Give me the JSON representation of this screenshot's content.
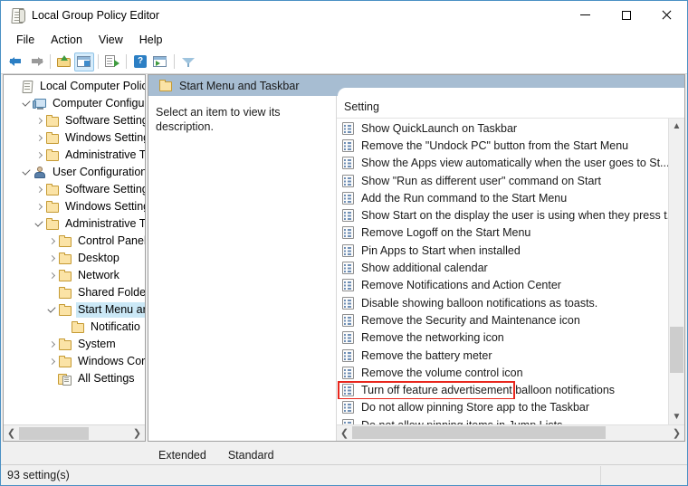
{
  "window": {
    "title": "Local Group Policy Editor",
    "icon": "policy-document-icon",
    "controls": {
      "minimize": "Minimize",
      "maximize": "Maximize",
      "close": "Close"
    }
  },
  "menubar": {
    "items": [
      {
        "label": "File"
      },
      {
        "label": "Action"
      },
      {
        "label": "View"
      },
      {
        "label": "Help"
      }
    ]
  },
  "toolbar": {
    "buttons": [
      {
        "name": "back-arrow-icon",
        "enabled": true
      },
      {
        "name": "forward-arrow-icon",
        "enabled": false
      },
      {
        "name": "up-one-level-icon",
        "enabled": true
      },
      {
        "name": "show-hide-console-tree-icon",
        "selected": true
      },
      {
        "name": "properties-icon",
        "enabled": true
      },
      {
        "name": "help-icon",
        "label": "?"
      },
      {
        "name": "show-action-pane-icon",
        "enabled": true
      },
      {
        "name": "filter-icon",
        "enabled": true
      }
    ]
  },
  "tree": {
    "items": [
      {
        "label": "Local Computer Policy",
        "indent": 0,
        "twisty": "none",
        "icon": "policy-document-icon",
        "selected": false
      },
      {
        "label": "Computer Configura",
        "indent": 1,
        "twisty": "open",
        "icon": "computer-icon",
        "selected": false
      },
      {
        "label": "Software Settings",
        "indent": 2,
        "twisty": "closed",
        "icon": "folder-icon",
        "selected": false
      },
      {
        "label": "Windows Setting",
        "indent": 2,
        "twisty": "closed",
        "icon": "folder-icon",
        "selected": false
      },
      {
        "label": "Administrative Te",
        "indent": 2,
        "twisty": "closed",
        "icon": "folder-icon",
        "selected": false
      },
      {
        "label": "User Configuration",
        "indent": 1,
        "twisty": "open",
        "icon": "user-icon",
        "selected": false
      },
      {
        "label": "Software Settings",
        "indent": 2,
        "twisty": "closed",
        "icon": "folder-icon",
        "selected": false
      },
      {
        "label": "Windows Setting",
        "indent": 2,
        "twisty": "closed",
        "icon": "folder-icon",
        "selected": false
      },
      {
        "label": "Administrative Te",
        "indent": 2,
        "twisty": "open",
        "icon": "folder-icon",
        "selected": false
      },
      {
        "label": "Control Panel",
        "indent": 3,
        "twisty": "closed",
        "icon": "folder-icon",
        "selected": false
      },
      {
        "label": "Desktop",
        "indent": 3,
        "twisty": "closed",
        "icon": "folder-icon",
        "selected": false
      },
      {
        "label": "Network",
        "indent": 3,
        "twisty": "closed",
        "icon": "folder-icon",
        "selected": false
      },
      {
        "label": "Shared Folder",
        "indent": 3,
        "twisty": "none",
        "icon": "folder-icon",
        "selected": false
      },
      {
        "label": "Start Menu ar",
        "indent": 3,
        "twisty": "open",
        "icon": "folder-icon",
        "selected": true
      },
      {
        "label": "Notificatio",
        "indent": 4,
        "twisty": "none",
        "icon": "folder-icon",
        "selected": false
      },
      {
        "label": "System",
        "indent": 3,
        "twisty": "closed",
        "icon": "folder-icon",
        "selected": false
      },
      {
        "label": "Windows Cor",
        "indent": 3,
        "twisty": "closed",
        "icon": "folder-icon",
        "selected": false
      },
      {
        "label": "All Settings",
        "indent": 3,
        "twisty": "none",
        "icon": "all-settings-icon",
        "selected": false
      }
    ]
  },
  "pane_header": {
    "title": "Start Menu and Taskbar",
    "icon": "folder-icon"
  },
  "description": {
    "text": "Select an item to view its description."
  },
  "list": {
    "column_header": "Setting",
    "highlighted_index": 15,
    "rows": [
      {
        "label": "Show QuickLaunch on Taskbar"
      },
      {
        "label": "Remove the \"Undock PC\" button from the Start Menu"
      },
      {
        "label": "Show the Apps view automatically when the user goes to St..."
      },
      {
        "label": "Show \"Run as different user\" command on Start"
      },
      {
        "label": "Add the Run command to the Start Menu"
      },
      {
        "label": "Show Start on the display the user is using when they press t..."
      },
      {
        "label": "Remove Logoff on the Start Menu"
      },
      {
        "label": "Pin Apps to Start when installed"
      },
      {
        "label": "Show additional calendar"
      },
      {
        "label": "Remove Notifications and Action Center"
      },
      {
        "label": "Disable showing balloon notifications as toasts."
      },
      {
        "label": "Remove the Security and Maintenance icon"
      },
      {
        "label": "Remove the networking icon"
      },
      {
        "label": "Remove the battery meter"
      },
      {
        "label": "Remove the volume control icon"
      },
      {
        "label": "Turn off feature advertisement balloon notifications"
      },
      {
        "label": "Do not allow pinning Store app to the Taskbar"
      },
      {
        "label": "Do not allow pinning items in Jump Lists"
      }
    ]
  },
  "tabs": {
    "items": [
      {
        "label": "Extended",
        "active": false
      },
      {
        "label": "Standard",
        "active": true
      }
    ]
  },
  "statusbar": {
    "text": "93 setting(s)",
    "secondary": ""
  },
  "colors": {
    "accent": "#4a90c4",
    "pane_header": "#a7bdd2",
    "selection": "#cbe8f6",
    "highlight_box": "#e8261c",
    "scrollbar_thumb": "#cdcdcd"
  }
}
